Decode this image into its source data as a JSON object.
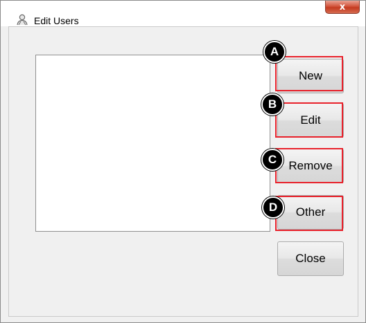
{
  "window": {
    "title": "Edit Users",
    "close_glyph": "x",
    "title_icon": "user-icon"
  },
  "list": {
    "items": []
  },
  "buttons": {
    "new_label": "New",
    "edit_label": "Edit",
    "remove_label": "Remove",
    "other_label": "Other",
    "close_label": "Close"
  },
  "callouts": {
    "a": "A",
    "b": "B",
    "c": "C",
    "d": "D",
    "highlight_color": "#e8202a",
    "badge_color": "#000000"
  }
}
